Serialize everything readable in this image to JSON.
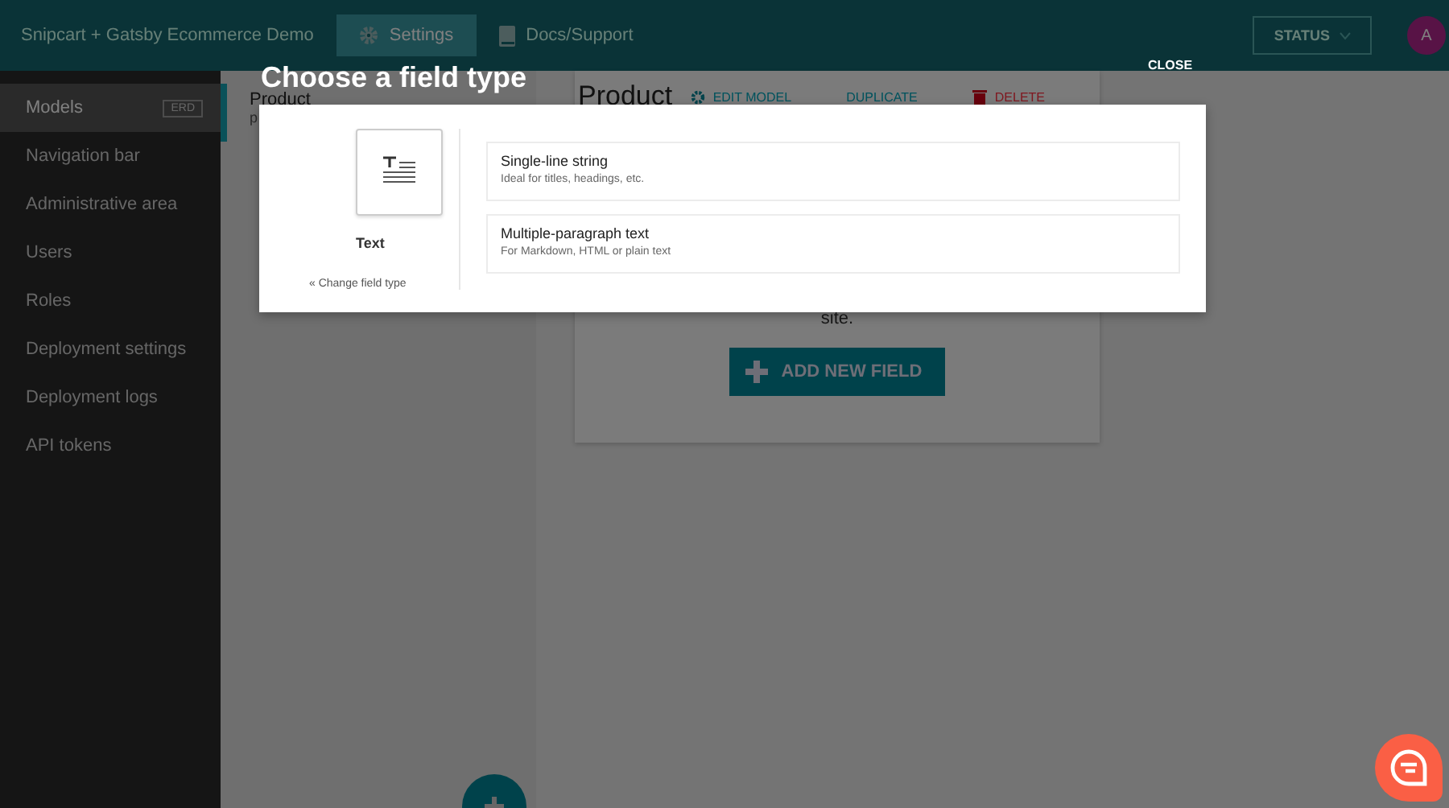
{
  "header": {
    "title": "Snipcart + Gatsby Ecommerce Demo",
    "tabs": [
      {
        "label": "Settings",
        "kind": "gear",
        "selected": true
      },
      {
        "label": "Docs/Support",
        "kind": "book",
        "selected": false
      }
    ],
    "status_button": "STATUS",
    "avatar": "A"
  },
  "sidebar": {
    "items": [
      {
        "label": "Models",
        "badge": "ERD",
        "selected": true
      },
      {
        "label": "Navigation bar",
        "selected": false
      },
      {
        "label": "Administrative area",
        "selected": false
      },
      {
        "label": "Users",
        "selected": false
      },
      {
        "label": "Roles",
        "selected": false
      },
      {
        "label": "Deployment settings",
        "selected": false
      },
      {
        "label": "Deployment logs",
        "selected": false
      },
      {
        "label": "API tokens",
        "selected": false
      }
    ]
  },
  "model_list": {
    "items": [
      {
        "title": "Product",
        "subtitle": "p",
        "selected": true
      }
    ]
  },
  "card": {
    "title": "Product",
    "actions": [
      {
        "label": "EDIT MODEL",
        "kind": "edit"
      },
      {
        "label": "DUPLICATE",
        "kind": "duplicate"
      },
      {
        "label": "DELETE",
        "kind": "delete"
      }
    ],
    "text": "site.",
    "button": "ADD NEW FIELD"
  },
  "modal": {
    "title": "Choose a field type",
    "close": "CLOSE",
    "field_type": {
      "label": "Text",
      "link": "« Change field type"
    },
    "options": [
      {
        "title": "Single-line string",
        "description": "Ideal for titles, headings, etc."
      },
      {
        "title": "Multiple-paragraph text",
        "description": "For Markdown, HTML or plain text"
      }
    ]
  }
}
